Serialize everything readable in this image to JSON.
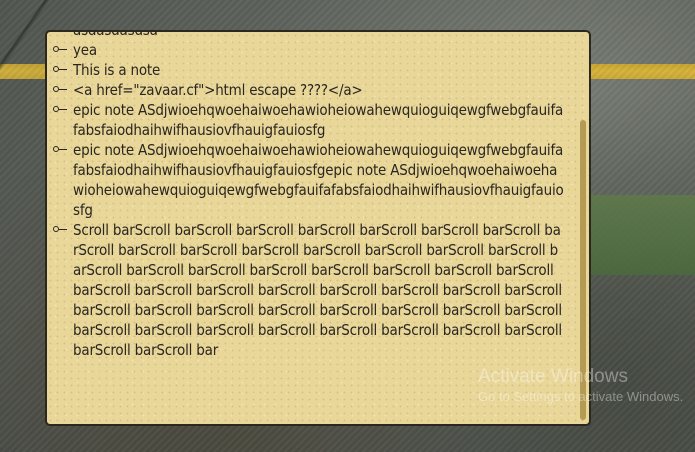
{
  "notes": {
    "items": [
      "asdasdasdsa",
      "yea",
      "This is a note",
      "<a href=\"zavaar.cf\">html escape ????</a>",
      "epic note ASdjwioehqwoehaiwoehawioheiowahewquioguiqewgfwebgfauifafabsfaiodhaihwifhausiovfhauigfauiosfg",
      "epic note ASdjwioehqwoehaiwoehawioheiowahewquioguiqewgfwebgfauifafabsfaiodhaihwifhausiovfhauigfauiosfgepic note ASdjwioehqwoehaiwoehawioheiowahewquioguiqewgfwebgfauifafabsfaiodhaihwifhausiovfhauigfauiosfg",
      "Scroll barScroll barScroll barScroll barScroll barScroll barScroll barScroll barScroll barScroll barScroll barScroll barScroll barScroll barScroll barScroll barScroll barScroll barScroll barScroll barScroll barScroll barScroll barScroll barScroll barScroll barScroll barScroll barScroll barScroll barScroll barScroll barScroll barScroll barScroll barScroll barScroll barScroll barScroll barScroll barScroll barScroll barScroll barScroll barScroll barScroll barScroll barScroll barScroll barScroll bar"
    ]
  },
  "watermark": {
    "title": "Activate Windows",
    "subtitle": "Go to Settings to activate Windows."
  },
  "colors": {
    "panel": "#e9d79a",
    "border": "#2b2820",
    "text": "#2a2620",
    "scrollbar": "#b49a52"
  }
}
